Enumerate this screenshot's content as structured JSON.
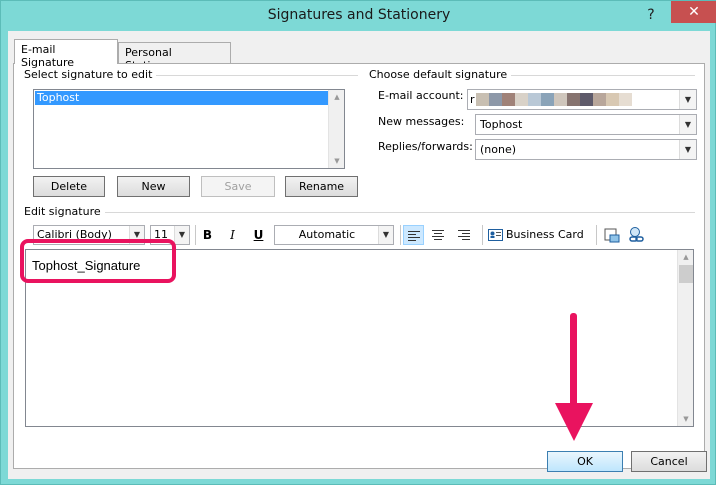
{
  "window": {
    "title": "Signatures and Stationery",
    "help_glyph": "?",
    "close_glyph": "✕"
  },
  "tabs": [
    {
      "label": "E-mail Signature",
      "active": true
    },
    {
      "label": "Personal Stationery",
      "active": false
    }
  ],
  "select_signature": {
    "label": "Select signature to edit",
    "items": [
      "Tophost"
    ],
    "selected": "Tophost"
  },
  "buttons": {
    "delete": "Delete",
    "new": "New",
    "save": "Save",
    "rename": "Rename",
    "ok": "OK",
    "cancel": "Cancel"
  },
  "default_signature": {
    "label": "Choose default signature",
    "email_account_label": "E-mail account:",
    "email_account_value_prefix": "r",
    "new_messages_label": "New messages:",
    "new_messages_value": "Tophost",
    "replies_label": "Replies/forwards:",
    "replies_value": "(none)"
  },
  "edit_signature": {
    "label": "Edit signature",
    "font": "Calibri (Body)",
    "size": "11",
    "bold": "B",
    "italic": "I",
    "underline": "U",
    "color": "Automatic",
    "business_card_label": "Business Card",
    "content": "Tophost_Signature"
  },
  "colors": {
    "accent": "#3399ff",
    "highlight": "#e9135f",
    "window_frame": "#7dd9d6",
    "close_button": "#c75050"
  },
  "icons": {
    "help": "help-icon",
    "close": "close-icon",
    "combo_arrow": "chevron-down-icon",
    "align_left": "align-left-icon",
    "align_center": "align-center-icon",
    "align_right": "align-right-icon",
    "business_card": "business-card-icon",
    "insert_picture": "insert-picture-icon",
    "insert_hyperlink": "hyperlink-icon",
    "annotation_arrow": "arrow-down-icon"
  }
}
